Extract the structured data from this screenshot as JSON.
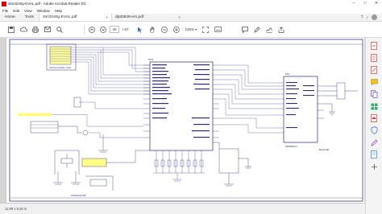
{
  "window": {
    "title": "stm3240g-EVAL.pdf - Adobe Acrobat Reader DC",
    "controls": [
      "–",
      "□",
      "✕"
    ]
  },
  "menu": [
    "File",
    "Edit",
    "View",
    "Window",
    "Help"
  ],
  "tabs": {
    "home": "Home",
    "tools": "Tools",
    "documents": [
      {
        "label": "stm3240g-EVAL.pdf",
        "active": true
      },
      {
        "label": "dp83848-ern.pdf",
        "active": false
      }
    ],
    "close_glyph": "×"
  },
  "toolbar": {
    "page_current": "40",
    "page_total": "/ 67",
    "zoom": "125%"
  },
  "icons": {
    "save": "save-icon",
    "upload": "upload-icon",
    "print": "print-icon",
    "mail": "mail-icon",
    "search": "search-icon",
    "prev": "arrow-up-icon",
    "next": "arrow-down-icon",
    "select": "cursor-icon",
    "hand": "hand-icon",
    "zoom_out": "zoom-out-icon",
    "zoom_in": "zoom-in-icon",
    "fit": "fit-page-icon",
    "keyboard": "keyboard-icon",
    "comment": "comment-icon",
    "pen": "pen-icon",
    "sign": "sign-icon",
    "share": "share-icon"
  },
  "schematic": {
    "left_box_label": "Connect to EVAL mode",
    "chip_top_label": "STM",
    "chip2_label": "PHY",
    "chip2_part": "DP83848CVV",
    "bottom_label": "STM32F407/429",
    "right_note": "Backup SEL"
  },
  "status": {
    "page_size": "11.69 x 8.26 in"
  },
  "colors": {
    "acrobat_red": "#d40000",
    "wire": "#6a6aa8",
    "component": "#2b2b7a",
    "highlight": "#ffff66"
  }
}
